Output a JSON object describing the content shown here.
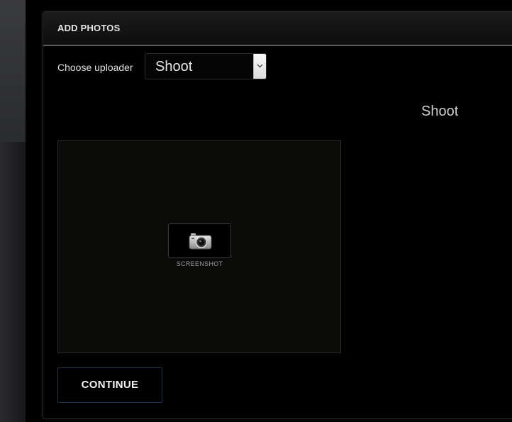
{
  "panel": {
    "title": "ADD PHOTOS"
  },
  "uploader": {
    "label": "Choose uploader",
    "selected": "Shoot"
  },
  "mode_heading": "Shoot",
  "camera": {
    "screenshot_label": "SCREENSHOT"
  },
  "actions": {
    "continue_label": "CONTINUE"
  },
  "icons": {
    "camera": "camera-icon",
    "select_arrow": "chevron-down-icon"
  },
  "colors": {
    "background": "#000000",
    "header_rule": "#5a5a5a",
    "continue_border": "#1c3350"
  }
}
